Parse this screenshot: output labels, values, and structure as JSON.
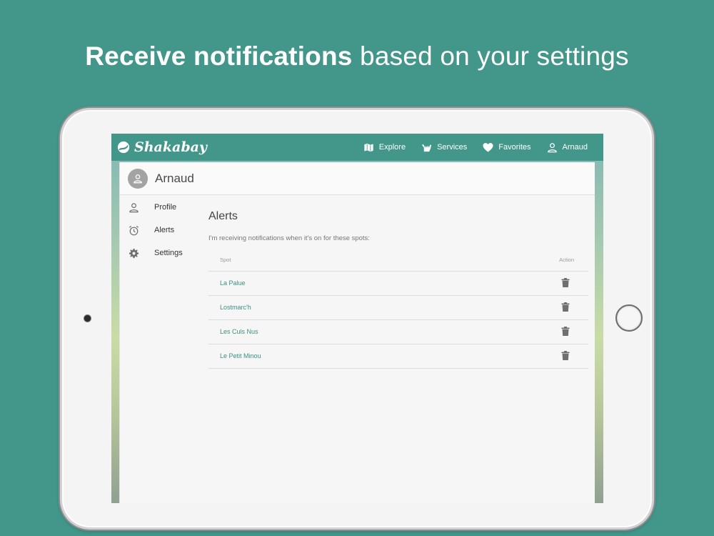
{
  "headline": {
    "bold": "Receive notifications",
    "light": " based on your settings"
  },
  "app": {
    "brand": "Shakabay",
    "nav": [
      {
        "label": "Explore",
        "icon": "map-icon"
      },
      {
        "label": "Services",
        "icon": "shaka-icon"
      },
      {
        "label": "Favorites",
        "icon": "heart-icon"
      },
      {
        "label": "Arnaud",
        "icon": "user-icon"
      }
    ]
  },
  "user": {
    "name": "Arnaud"
  },
  "sidebar": {
    "items": [
      {
        "label": "Profile",
        "icon": "user-icon"
      },
      {
        "label": "Alerts",
        "icon": "alarm-clock-icon"
      },
      {
        "label": "Settings",
        "icon": "gear-icon"
      }
    ]
  },
  "alerts": {
    "title": "Alerts",
    "description": "I'm receiving notifications when it's on for these spots:",
    "columns": {
      "spot": "Spot",
      "action": "Action"
    },
    "rows": [
      {
        "spot": "La Palue"
      },
      {
        "spot": "Lostmarc'h"
      },
      {
        "spot": "Les Culs Nus"
      },
      {
        "spot": "Le Petit Minou"
      }
    ]
  },
  "colors": {
    "brand": "#42968a",
    "link": "#3b8f83",
    "icon": "#6f6f6f"
  }
}
